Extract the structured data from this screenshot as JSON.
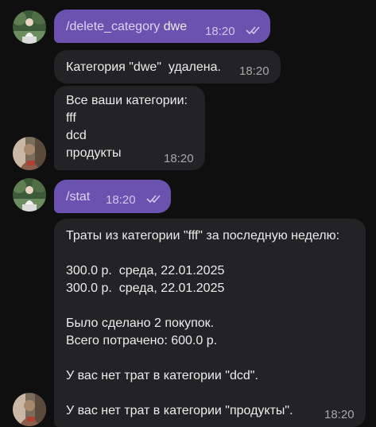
{
  "messages": {
    "m1": {
      "cmd": "/delete_category",
      "arg": " dwe",
      "time": "18:20"
    },
    "m2": {
      "text": "Категория \"dwe\"  удалена.",
      "time": "18:20"
    },
    "m3": {
      "lines": [
        "Все ваши категории:",
        "fff",
        "dcd",
        "продукты"
      ],
      "time": "18:20"
    },
    "m4": {
      "cmd": "/stat",
      "time": "18:20"
    },
    "m5": {
      "lines": [
        "Траты из категории \"fff\" за последную неделю:",
        "",
        "300.0 р.  среда, 22.01.2025",
        "300.0 р.  среда, 22.01.2025",
        "",
        "Было сделано 2 покупок.",
        "Всего потрачено: 600.0 р.",
        "",
        "У вас нет трат в категории \"dcd\".",
        "",
        "У вас нет трат в категории \"продукты\"."
      ],
      "time": "18:20"
    }
  },
  "colors": {
    "background": "#0f0f0f",
    "outgoing_bubble": "#6a52ae",
    "incoming_bubble": "#232326",
    "command_text": "#dcd3ff"
  },
  "icons": {
    "read_status": "double-check-icon",
    "user_avatar": "user-avatar",
    "bot_avatar": "bot-avatar"
  }
}
